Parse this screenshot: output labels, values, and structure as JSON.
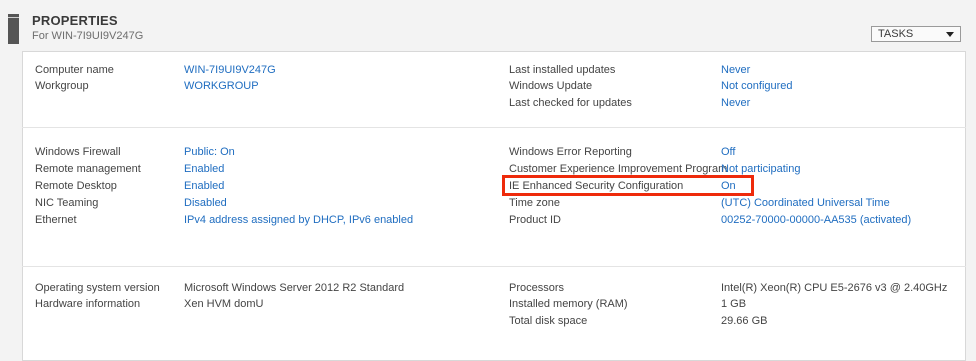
{
  "header": {
    "title": "PROPERTIES",
    "subtitle": "For WIN-7I9UI9V247G",
    "tasks_label": "TASKS"
  },
  "colors": {
    "link": "#1f6dc0",
    "highlight": "#ee2a0b"
  },
  "section1_left": [
    {
      "label": "Computer name",
      "value": "WIN-7I9UI9V247G"
    },
    {
      "label": "Workgroup",
      "value": "WORKGROUP"
    }
  ],
  "section1_right": [
    {
      "label": "Last installed updates",
      "value": "Never"
    },
    {
      "label": "Windows Update",
      "value": "Not configured"
    },
    {
      "label": "Last checked for updates",
      "value": "Never"
    }
  ],
  "section2_left": [
    {
      "label": "Windows Firewall",
      "value": "Public: On"
    },
    {
      "label": "Remote management",
      "value": "Enabled"
    },
    {
      "label": "Remote Desktop",
      "value": "Enabled"
    },
    {
      "label": "NIC Teaming",
      "value": "Disabled"
    },
    {
      "label": "Ethernet",
      "value": "IPv4 address assigned by DHCP, IPv6 enabled"
    }
  ],
  "section2_right": [
    {
      "label": "Windows Error Reporting",
      "value": "Off"
    },
    {
      "label": "Customer Experience Improvement Program",
      "value": "Not participating"
    },
    {
      "label": "IE Enhanced Security Configuration",
      "value": "On"
    },
    {
      "label": "Time zone",
      "value": "(UTC) Coordinated Universal Time"
    },
    {
      "label": "Product ID",
      "value": "00252-70000-00000-AA535 (activated)"
    }
  ],
  "section3_left": [
    {
      "label": "Operating system version",
      "value": "Microsoft Windows Server 2012 R2 Standard"
    },
    {
      "label": "Hardware information",
      "value": "Xen HVM domU"
    }
  ],
  "section3_right": [
    {
      "label": "Processors",
      "value": "Intel(R) Xeon(R) CPU E5-2676 v3 @ 2.40GHz"
    },
    {
      "label": "Installed memory (RAM)",
      "value": "1 GB"
    },
    {
      "label": "Total disk space",
      "value": "29.66 GB"
    }
  ]
}
